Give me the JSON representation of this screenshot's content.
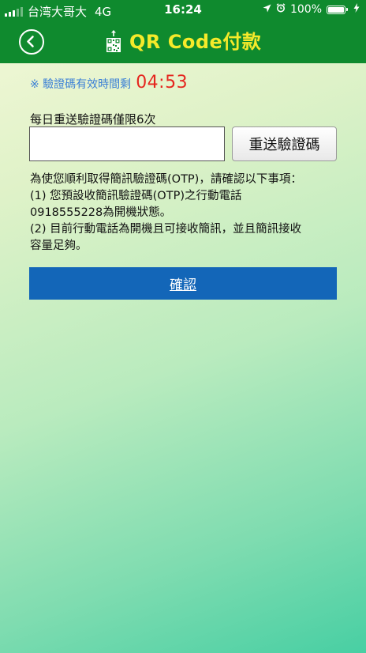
{
  "status_bar": {
    "carrier": "台湾大哥大",
    "network": "4G",
    "time": "16:24",
    "battery": "100%"
  },
  "header": {
    "title": "QR Code付款",
    "icons": [
      "back-icon",
      "qr-code-icon"
    ]
  },
  "timer": {
    "label": "※ 驗證碼有效時間剩",
    "value": "04:53"
  },
  "form": {
    "limit_label": "每日重送驗證碼僅限6次",
    "otp_value": "",
    "resend_label": "重送驗證碼"
  },
  "notice": {
    "lines": [
      "為使您順利取得簡訊驗證碼(OTP)，請確認以下事項：",
      "(1) 您預設收簡訊驗證碼(OTP)之行動電話",
      "0918555228為開機狀態。",
      "(2) 目前行動電話為開機且可接收簡訊，並且簡訊接收",
      "容量足夠。"
    ]
  },
  "confirm_label": "確認",
  "colors": {
    "header_bg": "#0f8a2e",
    "title": "#f6ea2a",
    "timer_label": "#3a7fd6",
    "timer_value": "#e5261f",
    "confirm_bg": "#1366b8"
  }
}
